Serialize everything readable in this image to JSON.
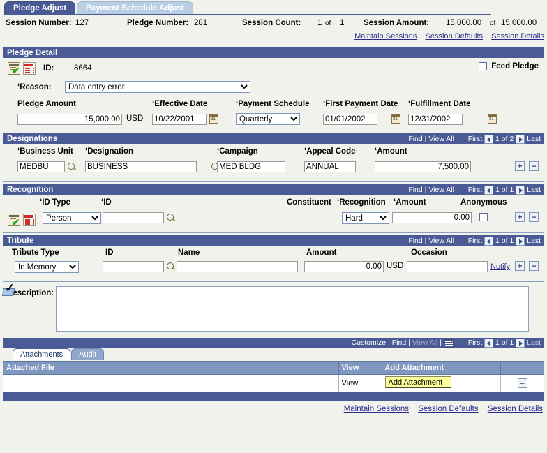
{
  "tabs": [
    {
      "label": "Pledge Adjust",
      "active": true
    },
    {
      "label": "Payment Schedule Adjust",
      "active": false
    }
  ],
  "header": {
    "session_number_label": "Session Number:",
    "session_number_value": "127",
    "pledge_number_label": "Pledge Number:",
    "pledge_number_value": "281",
    "session_count_label": "Session Count:",
    "session_count_value": "1",
    "session_count_of": "of",
    "session_count_total": "1",
    "session_amount_label": "Session Amount:",
    "session_amount_value": "15,000.00",
    "session_amount_of": "of",
    "session_amount_total": "15,000.00",
    "links": [
      "Maintain Sessions",
      "Session Defaults",
      "Session Details"
    ]
  },
  "pledge_detail": {
    "title": "Pledge Detail",
    "icons": [
      "form-check-icon",
      "red-list-icon"
    ],
    "id_label": "ID:",
    "id_value": "8664",
    "feed_pledge_label": "Feed Pledge",
    "feed_pledge_checked": false,
    "reason_label": "Reason:",
    "reason_value": "Data entry error",
    "reason_options": [
      "Data entry error"
    ],
    "pledge_amount_label": "Pledge Amount",
    "pledge_amount_value": "15,000.00",
    "currency": "USD",
    "effective_date_label": "Effective Date",
    "effective_date_value": "10/22/2001",
    "payment_schedule_label": "Payment Schedule",
    "payment_schedule_value": "Quarterly",
    "payment_schedule_options": [
      "Quarterly"
    ],
    "first_payment_date_label": "First Payment Date",
    "first_payment_date_value": "01/01/2002",
    "fulfillment_date_label": "Fulfillment Date",
    "fulfillment_date_value": "12/31/2002"
  },
  "designations": {
    "title": "Designations",
    "nav": {
      "find": "Find",
      "sep": "|",
      "view_all": "View All",
      "first": "First",
      "counter": "1 of 2",
      "last": "Last"
    },
    "business_unit_label": "Business Unit",
    "business_unit_value": "MEDBU",
    "designation_label": "Designation",
    "designation_value": "BUSINESS",
    "campaign_label": "Campaign",
    "campaign_value": "MED BLDG",
    "appeal_code_label": "Appeal Code",
    "appeal_code_value": "ANNUAL",
    "amount_label": "Amount",
    "amount_value": "7,500.00",
    "add_button": "+",
    "remove_button": "−"
  },
  "recognition": {
    "title": "Recognition",
    "nav": {
      "find": "Find",
      "sep": "|",
      "view_all": "View All",
      "first": "First",
      "counter": "1 of 1",
      "last": "Last"
    },
    "icons": [
      "form-check-icon",
      "red-list-icon"
    ],
    "id_type_label": "ID Type",
    "id_type_value": "Person",
    "id_type_options": [
      "Person"
    ],
    "id_label": "ID",
    "id_value": "",
    "constituent_label": "Constituent",
    "recognition_label": "Recognition",
    "recognition_value": "Hard",
    "recognition_options": [
      "Hard"
    ],
    "amount_label": "Amount",
    "amount_value": "0.00",
    "anonymous_label": "Anonymous",
    "anonymous_checked": false,
    "add_button": "+",
    "remove_button": "−"
  },
  "tribute": {
    "title": "Tribute",
    "nav": {
      "find": "Find",
      "sep": "|",
      "view_all": "View All",
      "first": "First",
      "counter": "1 of 1",
      "last": "Last"
    },
    "tribute_type_label": "Tribute Type",
    "tribute_type_value": "In Memory",
    "tribute_type_options": [
      "In Memory"
    ],
    "id_label": "ID",
    "id_value": "",
    "name_label": "Name",
    "name_value": "",
    "amount_label": "Amount",
    "amount_value": "0.00",
    "currency": "USD",
    "occasion_label": "Occasion",
    "occasion_value": "",
    "notify_link": "Notify",
    "add_button": "+",
    "remove_button": "−"
  },
  "description": {
    "label": "Description:",
    "value": "",
    "spellcheck_icon": "spellcheck-icon"
  },
  "attachments": {
    "toolbar": {
      "customize": "Customize",
      "sep1": "|",
      "find": "Find",
      "sep2": "|",
      "view_all": "View All",
      "sep3": "|",
      "grid_icon": "download-grid-icon",
      "first": "First",
      "counter": "1 of 1",
      "last": "Last"
    },
    "tabs": [
      {
        "label": "Attachments",
        "active": true
      },
      {
        "label": "Audit",
        "active": false
      }
    ],
    "columns": [
      "Attached File",
      "View",
      "Add Attachment",
      ""
    ],
    "rows": [
      {
        "attached_file": "",
        "view": "View",
        "add_attachment": "Add Attachment",
        "remove": "−"
      }
    ]
  },
  "footer": {
    "links": [
      "Maintain Sessions",
      "Session Defaults",
      "Session Details"
    ]
  }
}
